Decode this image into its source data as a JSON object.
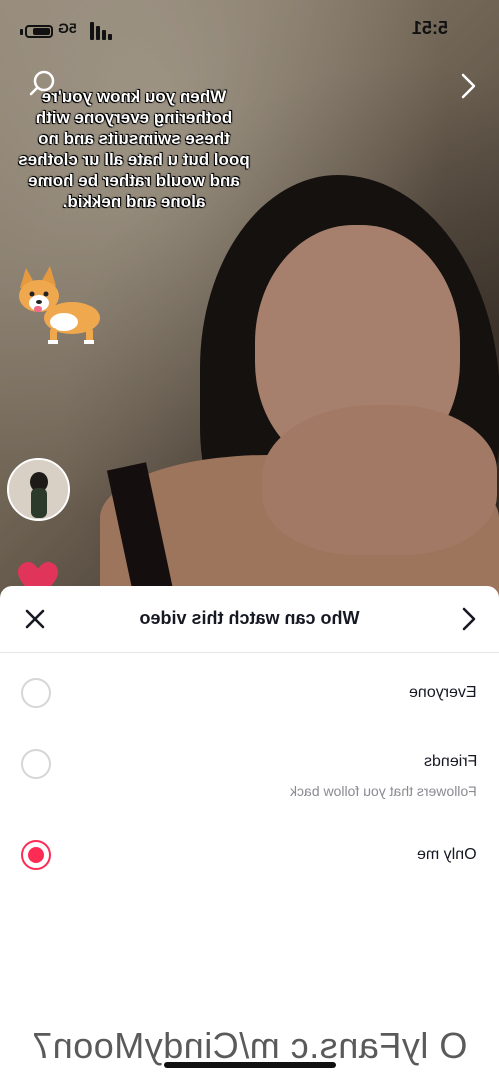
{
  "status_bar": {
    "time": "5:51",
    "network": "5G",
    "battery_level": 0.75
  },
  "video": {
    "caption": "When you know you're bothering everyone with these swimsuits and no pool but u hate all ur clothes and would rather be home alone and nekkid."
  },
  "privacy_sheet": {
    "title": "Who can watch this video",
    "options": [
      {
        "label": "Everyone",
        "sublabel": "",
        "selected": false
      },
      {
        "label": "Friends",
        "sublabel": "Followers that you follow back",
        "selected": false
      },
      {
        "label": "Only me",
        "sublabel": "",
        "selected": true
      }
    ]
  },
  "watermark": "O lyFans.c m/CindyMoon7",
  "colors": {
    "accent": "#fe2c55",
    "text": "#161823",
    "subtext": "#8a8b91"
  },
  "icons": {
    "search": "search-icon",
    "next": "chevron-right-icon",
    "close": "close-icon",
    "back": "chevron-right-icon"
  }
}
